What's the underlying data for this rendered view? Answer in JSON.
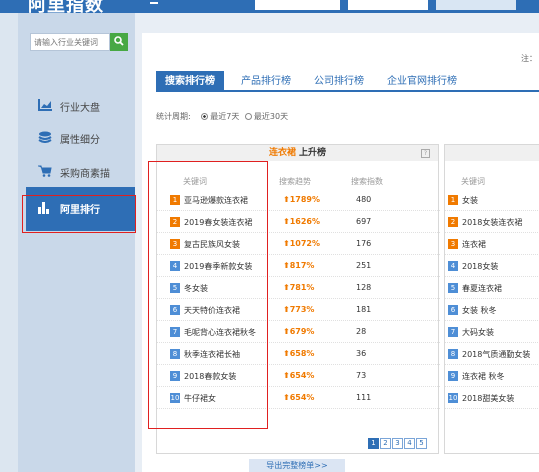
{
  "header": {
    "title": "阿里指数"
  },
  "sidebar": {
    "search_placeholder": "请输入行业关键词",
    "items": [
      {
        "label": "行业大盘",
        "icon": "chart-icon"
      },
      {
        "label": "属性细分",
        "icon": "layers-icon"
      },
      {
        "label": "采购商素描",
        "icon": "cart-icon"
      },
      {
        "label": "阿里排行",
        "icon": "bar-chart-icon"
      }
    ]
  },
  "main": {
    "corner_note": "注：",
    "tabs": [
      "搜索排行榜",
      "产品排行榜",
      "公司排行榜",
      "企业官网排行榜"
    ],
    "period": {
      "label": "统计周期:",
      "options": [
        {
          "label": "最近7天",
          "selected": true
        },
        {
          "label": "最近30天",
          "selected": false
        }
      ]
    },
    "panel1": {
      "header_keyword": "连衣裙",
      "header_rest": "上升榜",
      "help_icon": "?",
      "columns": [
        "关键词",
        "搜索趋势",
        "搜索指数"
      ],
      "rows": [
        {
          "rank": "1",
          "keyword": "亚马逊爆款连衣裙",
          "trend": "1789%",
          "index": "480"
        },
        {
          "rank": "2",
          "keyword": "2019春女装连衣裙",
          "trend": "1626%",
          "index": "697"
        },
        {
          "rank": "3",
          "keyword": "复古民族风女装",
          "trend": "1072%",
          "index": "176"
        },
        {
          "rank": "4",
          "keyword": "2019春季新款女装",
          "trend": "817%",
          "index": "251"
        },
        {
          "rank": "5",
          "keyword": "冬女装",
          "trend": "781%",
          "index": "128"
        },
        {
          "rank": "6",
          "keyword": "天天特价连衣裙",
          "trend": "773%",
          "index": "181"
        },
        {
          "rank": "7",
          "keyword": "毛呢背心连衣裙秋冬",
          "trend": "679%",
          "index": "28"
        },
        {
          "rank": "8",
          "keyword": "秋季连衣裙长袖",
          "trend": "658%",
          "index": "36"
        },
        {
          "rank": "9",
          "keyword": "2018春款女装",
          "trend": "654%",
          "index": "73"
        },
        {
          "rank": "10",
          "keyword": "牛仔裙女",
          "trend": "654%",
          "index": "111"
        }
      ],
      "pages": [
        "1",
        "2",
        "3",
        "4",
        "5"
      ]
    },
    "panel2": {
      "columns": [
        "关键词"
      ],
      "rows": [
        {
          "rank": "1",
          "keyword": "女装"
        },
        {
          "rank": "2",
          "keyword": "2018女装连衣裙"
        },
        {
          "rank": "3",
          "keyword": "连衣裙"
        },
        {
          "rank": "4",
          "keyword": "2018女装"
        },
        {
          "rank": "5",
          "keyword": "春夏连衣裙"
        },
        {
          "rank": "6",
          "keyword": "女装 秋冬"
        },
        {
          "rank": "7",
          "keyword": "大码女装"
        },
        {
          "rank": "8",
          "keyword": "2018气质通勤女装"
        },
        {
          "rank": "9",
          "keyword": "连衣裙 秋冬"
        },
        {
          "rank": "10",
          "keyword": "2018甜美女装"
        }
      ]
    },
    "export_label": "导出完整榜单>>"
  },
  "colors": {
    "brand": "#2e6eb5",
    "accent": "#f07a00",
    "search_button": "#47a844",
    "highlight": "#e02020"
  }
}
